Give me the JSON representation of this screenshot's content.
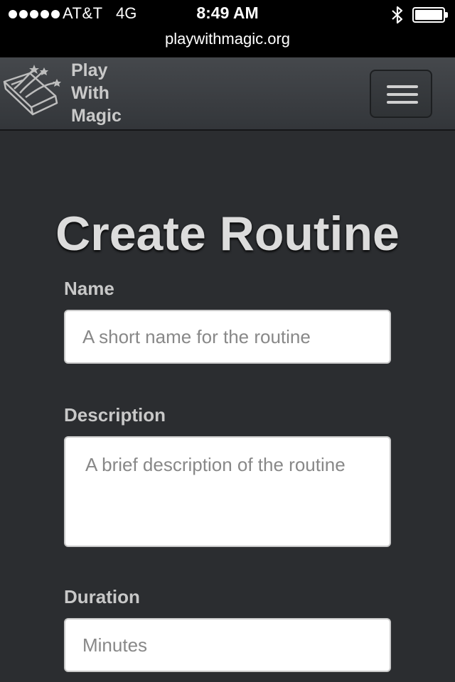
{
  "status_bar": {
    "carrier": "AT&T",
    "network": "4G",
    "time": "8:49 AM",
    "signal_bars": 5,
    "bluetooth_icon": "bluetooth-icon",
    "battery_icon": "battery-icon"
  },
  "browser": {
    "url": "playwithmagic.org"
  },
  "navbar": {
    "logo_icon": "magic-book-icon",
    "brand_line1": "Play",
    "brand_line2": "With",
    "brand_line3": "Magic",
    "menu_icon": "hamburger-menu-icon"
  },
  "main": {
    "title": "Create Routine",
    "form": {
      "name_label": "Name",
      "name_placeholder": "A short name for the routine",
      "name_value": "",
      "description_label": "Description",
      "description_placeholder": "A brief description of the routine",
      "description_value": "",
      "duration_label": "Duration",
      "duration_placeholder": "Minutes",
      "duration_value": ""
    }
  },
  "colors": {
    "page_background": "#2b2d30",
    "navbar": "#3d4044",
    "title_text": "#dcdcdc",
    "label_text": "#c8c8c8"
  }
}
